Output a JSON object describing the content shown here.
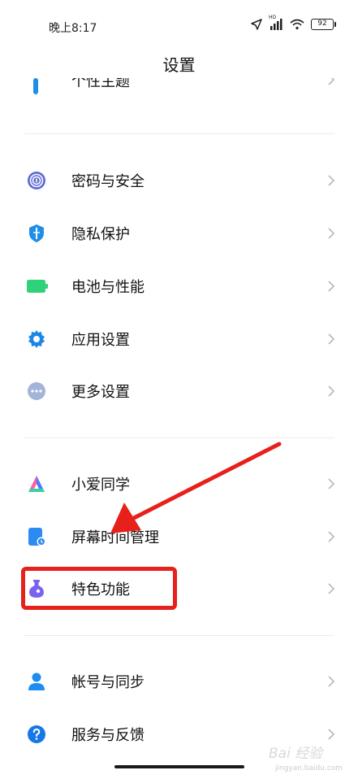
{
  "status_bar": {
    "time": "晚上8:17",
    "battery": "92",
    "network_badge": "HD"
  },
  "header": {
    "title": "设置"
  },
  "partial_item": {
    "label": "个性主题",
    "icon": "theme-icon"
  },
  "groups": [
    {
      "items": [
        {
          "label": "密码与安全",
          "icon": "fingerprint-icon",
          "color": "#5e6ad2"
        },
        {
          "label": "隐私保护",
          "icon": "privacy-shield-icon",
          "color": "#1f8ee8"
        },
        {
          "label": "电池与性能",
          "icon": "battery-icon",
          "color": "#2fd27a"
        },
        {
          "label": "应用设置",
          "icon": "gear-icon",
          "color": "#1c86e6"
        },
        {
          "label": "更多设置",
          "icon": "more-dots-icon",
          "color": "#a3b4d8"
        }
      ]
    },
    {
      "items": [
        {
          "label": "小爱同学",
          "icon": "xiaoai-icon",
          "color": "#4a7bff"
        },
        {
          "label": "屏幕时间管理",
          "icon": "screen-time-icon",
          "color": "#2b8bf0"
        },
        {
          "label": "特色功能",
          "icon": "flask-icon",
          "color": "#7b63f2"
        }
      ]
    },
    {
      "items": [
        {
          "label": "帐号与同步",
          "icon": "account-icon",
          "color": "#1e8cf0"
        },
        {
          "label": "服务与反馈",
          "icon": "help-icon",
          "color": "#1677e8"
        }
      ]
    }
  ],
  "annotation": {
    "highlight_color": "#e8201c"
  },
  "watermark": {
    "text": "Bai 经验",
    "url": "jingyan.baidu.com"
  }
}
